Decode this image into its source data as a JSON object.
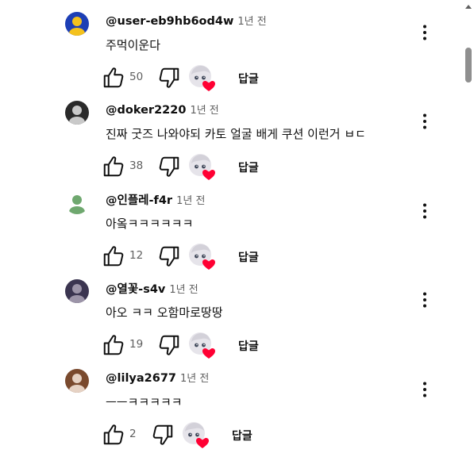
{
  "comments": [
    {
      "author": "@user-eb9hb6od4w",
      "time": "1년 전",
      "text": "주먹이운다",
      "likes": "50",
      "reply": "답글",
      "avatar_colors": [
        "#1d3fb5",
        "#f4c21d"
      ]
    },
    {
      "author": "@doker2220",
      "time": "1년 전",
      "text": "진짜 굿즈 나와야되 카토 얼굴 배게 쿠션 이런거 ㅂㄷ",
      "likes": "38",
      "reply": "답글",
      "avatar_colors": [
        "#2a2a2a",
        "#c9c9c9"
      ]
    },
    {
      "author": "@인플레-f4r",
      "time": "1년 전",
      "text": "아옼ㅋㅋㅋㅋㅋㅋ",
      "likes": "12",
      "reply": "답글",
      "avatar_colors": [
        "#ffffff",
        "#6fa86f"
      ]
    },
    {
      "author": "@열꽃-s4v",
      "time": "1년 전",
      "text": "아오 ㅋㅋ 오함마로땅땅",
      "likes": "19",
      "reply": "답글",
      "avatar_colors": [
        "#3b3550",
        "#9c94a8"
      ]
    },
    {
      "author": "@lilya2677",
      "time": "1년 전",
      "text": "ㅡㅡㅋㅋㅋㅋㅋ",
      "likes": "2",
      "reply": "답글",
      "avatar_colors": [
        "#7a4a2e",
        "#e6d2c4"
      ]
    }
  ],
  "colors": {
    "heart": "#ff0033",
    "text": "#0f0f0f",
    "meta": "#606060"
  },
  "icons": {
    "like": "thumb-up-icon",
    "dislike": "thumb-down-icon",
    "more": "more-vert-icon",
    "heart": "creator-heart-icon"
  }
}
